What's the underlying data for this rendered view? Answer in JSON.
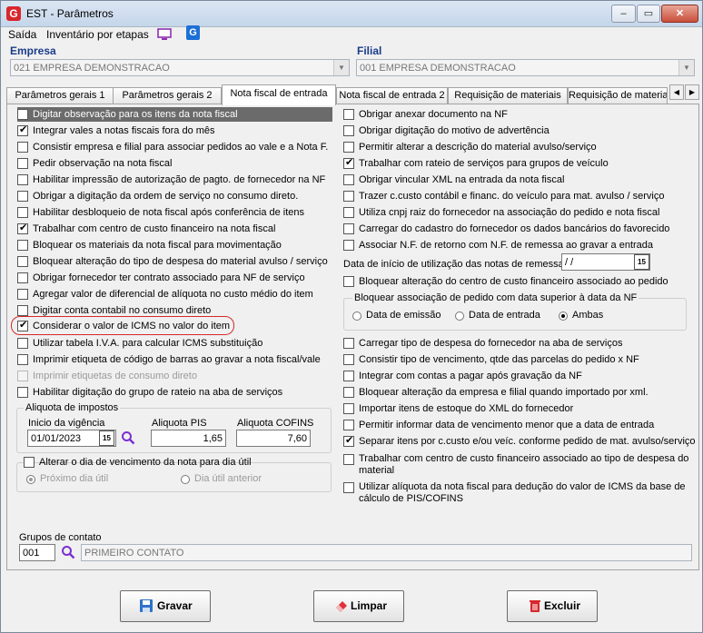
{
  "window": {
    "title": "EST - Parâmetros",
    "min": "–",
    "max": "▭",
    "close": "✕"
  },
  "menu": [
    "Saída",
    "Inventário por etapas"
  ],
  "empresa": {
    "label": "Empresa",
    "value": "021 EMPRESA DEMONSTRACAO"
  },
  "filial": {
    "label": "Filial",
    "value": "001 EMPRESA DEMONSTRACAO"
  },
  "tabs": [
    "Parâmetros gerais 1",
    "Parâmetros gerais 2",
    "Nota fiscal de entrada",
    "Nota fiscal de entrada 2",
    "Requisição de materiais",
    "Requisição de materiais"
  ],
  "left_checks": [
    {
      "label": "Digitar observação para os itens da nota fiscal",
      "checked": false
    },
    {
      "label": "Integrar vales a notas fiscais fora do mês",
      "checked": true
    },
    {
      "label": "Consistir empresa e filial para associar pedidos ao vale e a Nota F.",
      "checked": false
    },
    {
      "label": "Pedir observação na nota fiscal",
      "checked": false
    },
    {
      "label": "Habilitar impressão de autorização de pagto. de fornecedor na NF",
      "checked": false
    },
    {
      "label": "Obrigar a digitação da ordem de serviço no consumo direto.",
      "checked": false
    },
    {
      "label": "Habilitar desbloqueio de nota fiscal após conferência de itens",
      "checked": false
    },
    {
      "label": "Trabalhar com centro de custo financeiro na nota fiscal",
      "checked": true
    },
    {
      "label": "Bloquear os materiais da nota fiscal para movimentação",
      "checked": false
    },
    {
      "label": "Bloquear alteração do tipo de despesa do material avulso / serviço",
      "checked": false
    },
    {
      "label": "Obrigar fornecedor ter contrato associado para NF de serviço",
      "checked": false
    },
    {
      "label": "Agregar valor de diferencial de alíquota no custo médio do item",
      "checked": false
    },
    {
      "label": "Digitar conta contabil no consumo direto",
      "checked": false
    },
    {
      "label": "Considerar o valor de ICMS no valor do item",
      "checked": true
    },
    {
      "label": "Utilizar tabela I.V.A. para calcular ICMS substituição",
      "checked": false
    },
    {
      "label": "Imprimir etiqueta de código de barras ao gravar a nota fiscal/vale",
      "checked": false
    },
    {
      "label": "Imprimir etiquetas de consumo direto",
      "checked": false
    },
    {
      "label": "Habilitar digitação do grupo de rateio na aba de serviços",
      "checked": false
    }
  ],
  "aliquota": {
    "title": "Aliquota de impostos",
    "vigencia_label": "Inicio da vigência",
    "vigencia_value": "01/01/2023",
    "pis_label": "Aliquota PIS",
    "pis_value": "1,65",
    "cofins_label": "Aliquota COFINS",
    "cofins_value": "7,60"
  },
  "vencimento": {
    "title": "Alterar o dia de vencimento da nota para dia útil",
    "opt1": "Próximo dia útil",
    "opt2": "Dia útil anterior"
  },
  "grupos": {
    "label": "Grupos de contato",
    "code": "001",
    "name": "PRIMEIRO CONTATO"
  },
  "right_checks_top": [
    {
      "label": "Obrigar anexar documento na NF",
      "checked": false
    },
    {
      "label": "Obrigar digitação do motivo de advertência",
      "checked": false
    },
    {
      "label": "Permitir alterar a descrição do material avulso/serviço",
      "checked": false
    },
    {
      "label": "Trabalhar com rateio de serviços para grupos de veículo",
      "checked": true
    },
    {
      "label": "Obrigar vincular XML na entrada da nota fiscal",
      "checked": false
    },
    {
      "label": "Trazer c.custo contábil e financ. do veículo para mat. avulso / serviço",
      "checked": false
    },
    {
      "label": "Utiliza cnpj raiz do fornecedor na associação do pedido e nota fiscal",
      "checked": false
    },
    {
      "label": "Carregar do cadastro do fornecedor os dados bancários do favorecido",
      "checked": false
    },
    {
      "label": "Associar N.F. de retorno com N.F. de remessa ao gravar a entrada",
      "checked": false
    }
  ],
  "data_inicio": {
    "label": "Data de início de utilização das notas de remessa",
    "value": " / /"
  },
  "bloq_cc": {
    "label": "Bloquear alteração do centro de custo financeiro associado ao pedido",
    "checked": false
  },
  "bloq_pedido": {
    "title": "Bloquear associação de pedido com data superior à data da NF",
    "opts": [
      "Data de emissão",
      "Data de entrada",
      "Ambas"
    ]
  },
  "right_checks_bottom": [
    {
      "label": "Carregar tipo de despesa do fornecedor na aba de serviços",
      "checked": false
    },
    {
      "label": "Consistir tipo de vencimento, qtde das parcelas do pedido x NF",
      "checked": false
    },
    {
      "label": "Integrar com contas a pagar após gravação da NF",
      "checked": false
    },
    {
      "label": "Bloquear alteração da empresa e filial quando importado por xml.",
      "checked": false
    },
    {
      "label": "Importar itens de estoque do XML do fornecedor",
      "checked": false
    },
    {
      "label": "Permitir informar data de vencimento menor que a data de entrada",
      "checked": false
    },
    {
      "label": "Separar itens por c.custo e/ou veíc. conforme pedido de mat. avulso/serviço",
      "checked": true
    }
  ],
  "right_multi": [
    {
      "label": "Trabalhar com centro de custo financeiro associado ao tipo de despesa do material",
      "checked": false
    },
    {
      "label": "Utilizar alíquota da nota fiscal para dedução do valor de ICMS da base de cálculo de PIS/COFINS",
      "checked": false
    }
  ],
  "buttons": {
    "save": "Gravar",
    "clear": "Limpar",
    "delete": "Excluir"
  },
  "colors": {
    "highlight": "#d32a2a",
    "label_blue": "#1a3c8a",
    "brand_red": "#d9262c"
  }
}
